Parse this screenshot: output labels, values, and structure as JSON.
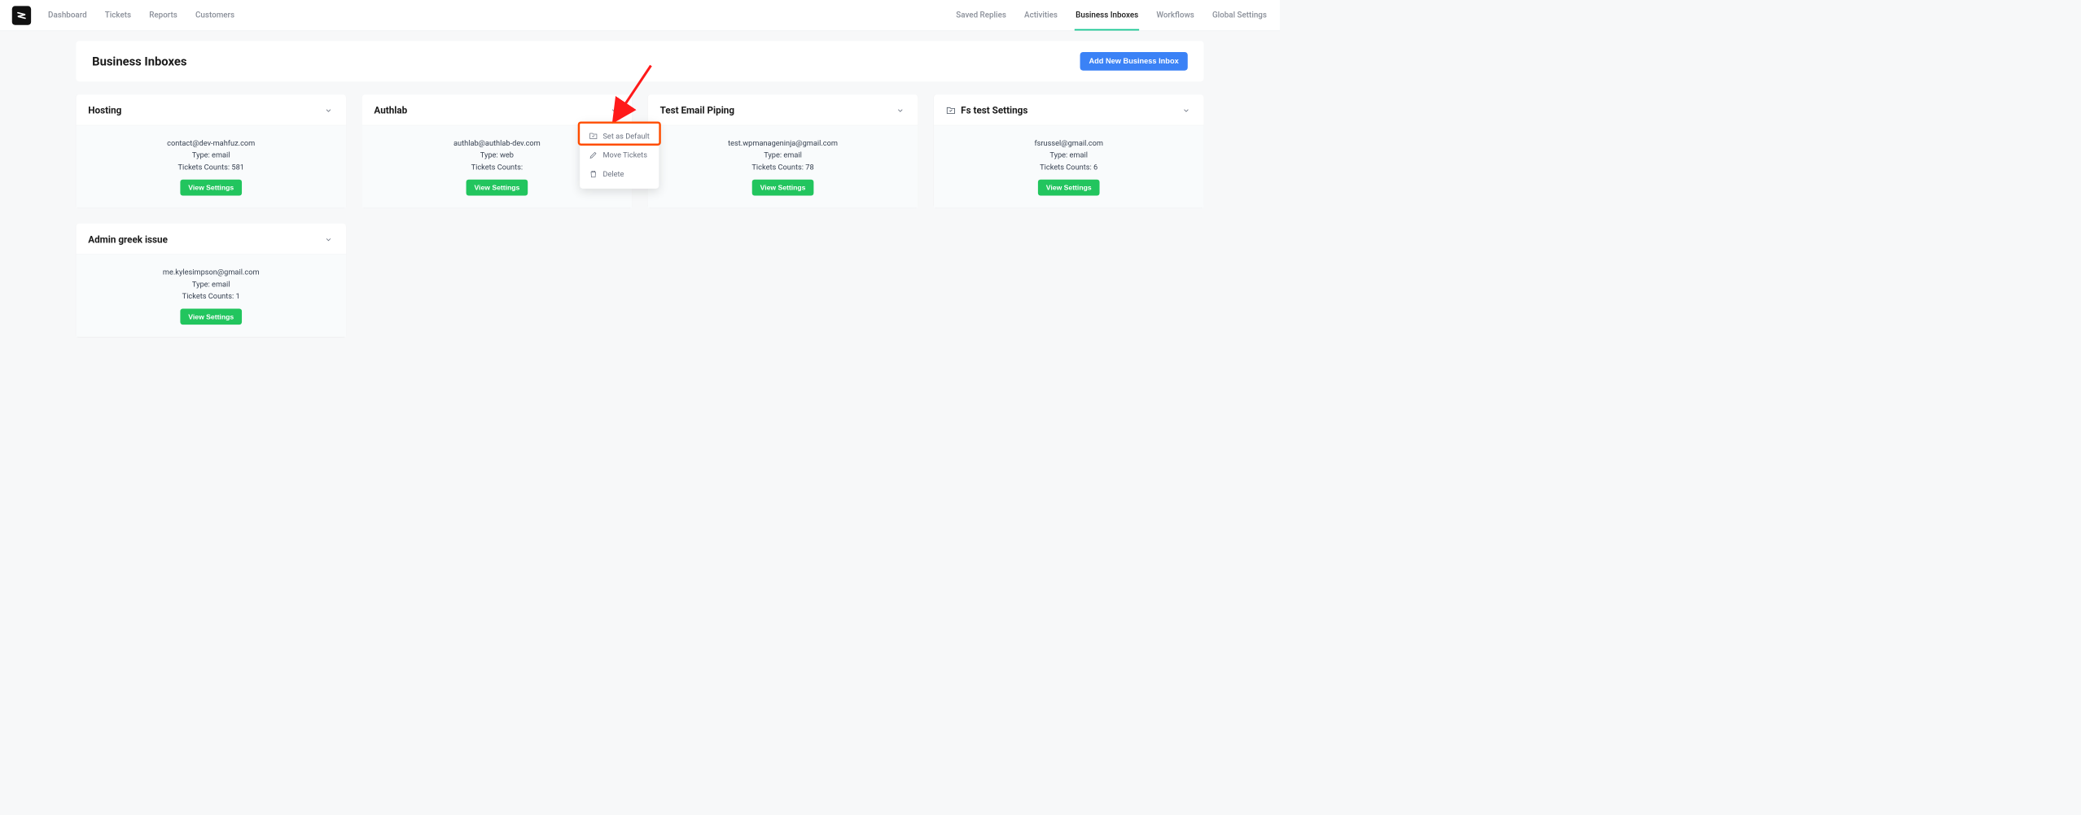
{
  "nav": {
    "left": [
      "Dashboard",
      "Tickets",
      "Reports",
      "Customers"
    ],
    "right": [
      "Saved Replies",
      "Activities",
      "Business Inboxes",
      "Workflows",
      "Global Settings"
    ],
    "activeRight": "Business Inboxes"
  },
  "header": {
    "title": "Business Inboxes",
    "addBtn": "Add New Business Inbox"
  },
  "labels": {
    "typePrefix": "Type: ",
    "ticketsPrefix": "Tickets Counts: ",
    "viewSettings": "View Settings"
  },
  "dropdown": {
    "setDefault": "Set as Default",
    "moveTickets": "Move Tickets",
    "delete": "Delete"
  },
  "cards": [
    {
      "title": "Hosting",
      "email": "contact@dev-mahfuz.com",
      "type": "email",
      "count": "581",
      "default": false
    },
    {
      "title": "Authlab",
      "email": "authlab@authlab-dev.com",
      "type": "web",
      "count": "",
      "default": false,
      "open": true
    },
    {
      "title": "Test Email Piping",
      "email": "test.wpmanageninja@gmail.com",
      "type": "email",
      "count": "78",
      "default": false
    },
    {
      "title": "Fs test Settings",
      "email": "fsrussel@gmail.com",
      "type": "email",
      "count": "6",
      "default": true
    },
    {
      "title": "Admin greek issue",
      "email": "me.kylesimpson@gmail.com",
      "type": "email",
      "count": "1",
      "default": false
    }
  ]
}
